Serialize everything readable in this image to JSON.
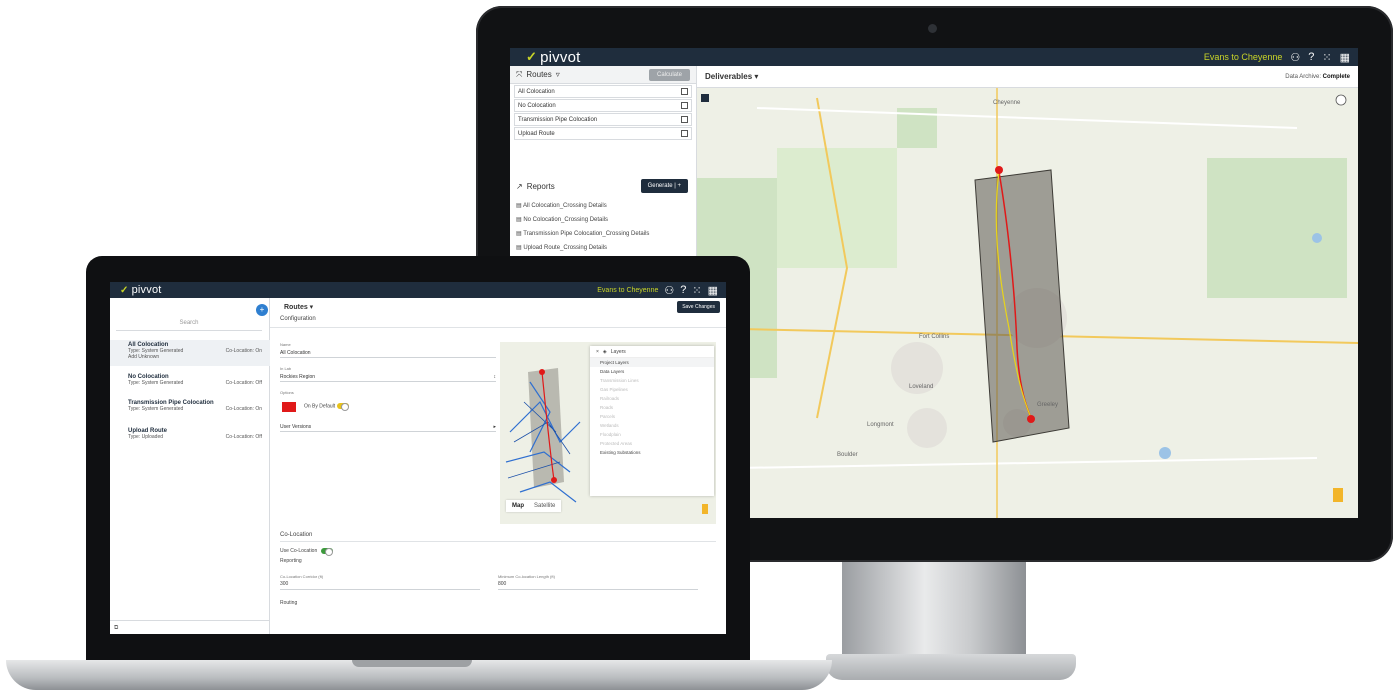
{
  "monitor": {
    "app": {
      "logo": "pivvot",
      "project_name": "Evans to Cheyenne",
      "sidebar": {
        "routes_label": "Routes",
        "calculate_label": "Calculate",
        "routes": [
          {
            "label": "All Colocation"
          },
          {
            "label": "No Colocation"
          },
          {
            "label": "Transmission Pipe Colocation"
          },
          {
            "label": "Upload Route"
          }
        ],
        "reports_label": "Reports",
        "generate_label": "Generate",
        "reports": [
          "All Colocation_Crossing Details",
          "No Colocation_Crossing Details",
          "Transmission Pipe Colocation_Crossing Details",
          "Upload Route_Crossing Details"
        ]
      },
      "main": {
        "dropdown": "Deliverables",
        "archive_label": "Data Archive:",
        "archive_value": "Complete"
      },
      "map": {
        "places": [
          "Cheyenne",
          "Fort Collins",
          "Loveland",
          "Greeley",
          "Longmont",
          "Boulder"
        ]
      }
    }
  },
  "laptop": {
    "app": {
      "logo": "pivvot",
      "project_name": "Evans to Cheyenne",
      "search_placeholder": "Search",
      "routes": [
        {
          "title": "All Colocation",
          "type": "Type: System Generated",
          "sub": "Add Unknown",
          "coloc": "Co-Location: On"
        },
        {
          "title": "No Colocation",
          "type": "Type: System Generated",
          "sub": "",
          "coloc": "Co-Location: Off"
        },
        {
          "title": "Transmission Pipe Colocation",
          "type": "Type: System Generated",
          "sub": "",
          "coloc": "Co-Location: On"
        },
        {
          "title": "Upload Route",
          "type": "Type: Uploaded",
          "sub": "",
          "coloc": "Co-Location: Off"
        }
      ],
      "main": {
        "dropdown": "Routes",
        "save_label": "Save Changes",
        "config_label": "Configuration",
        "name_label": "Name",
        "name_value": "All Colocation",
        "aoi_label": "In Lab",
        "aoi_value": "Rockies Region",
        "options_label": "Options",
        "on_by_default": "On By Default",
        "user_versions": "User Versions",
        "layers_title": "Layers",
        "project_layers": "Project Layers",
        "data_layers": "Data Layers",
        "layer_rows": [
          "Transmission Lines",
          "Gas Pipelines",
          "Railroads",
          "Roads",
          "Parcels",
          "Wetlands",
          "Floodplain",
          "Protected Areas",
          "Existing Substations"
        ],
        "map_tab_map": "Map",
        "map_tab_satellite": "Satellite",
        "coloc_head": "Co-Location",
        "use_coloc": "Use Co-Location",
        "reporting": "Reporting",
        "coloc_buffer_label": "Co-Location Corridor (ft)",
        "coloc_buffer_value": "300",
        "min_length_label": "Minimum Co-location Length (ft)",
        "min_length_value": "800",
        "routing": "Routing"
      }
    }
  },
  "colors": {
    "topbar": "#1f2d3d",
    "accent": "#c8d428",
    "route_red": "#e01919",
    "toggle_on": "#3c9a3c",
    "toggle_default": "#e8c21a"
  }
}
